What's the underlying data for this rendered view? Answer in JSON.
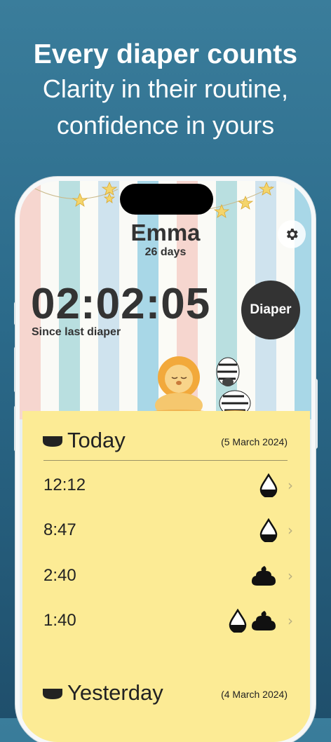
{
  "headline": {
    "title": "Every diaper counts",
    "line1": "Clarity in their routine,",
    "line2": "confidence in yours"
  },
  "baby": {
    "name": "Emma",
    "age": "26 days"
  },
  "timer": {
    "value": "02:02:05",
    "caption": "Since last diaper"
  },
  "actions": {
    "diaper_button": "Diaper"
  },
  "sections": [
    {
      "title": "Today",
      "date": "(5 March 2024)",
      "entries": [
        {
          "time": "12:12",
          "types": [
            "pee"
          ]
        },
        {
          "time": "8:47",
          "types": [
            "pee"
          ]
        },
        {
          "time": "2:40",
          "types": [
            "poo"
          ]
        },
        {
          "time": "1:40",
          "types": [
            "pee",
            "poo"
          ]
        }
      ]
    },
    {
      "title": "Yesterday",
      "date": "(4 March 2024)",
      "entries": []
    }
  ],
  "colors": {
    "background": "#2b6a8a",
    "list_background": "#fceb95",
    "button_dark": "#333333"
  }
}
